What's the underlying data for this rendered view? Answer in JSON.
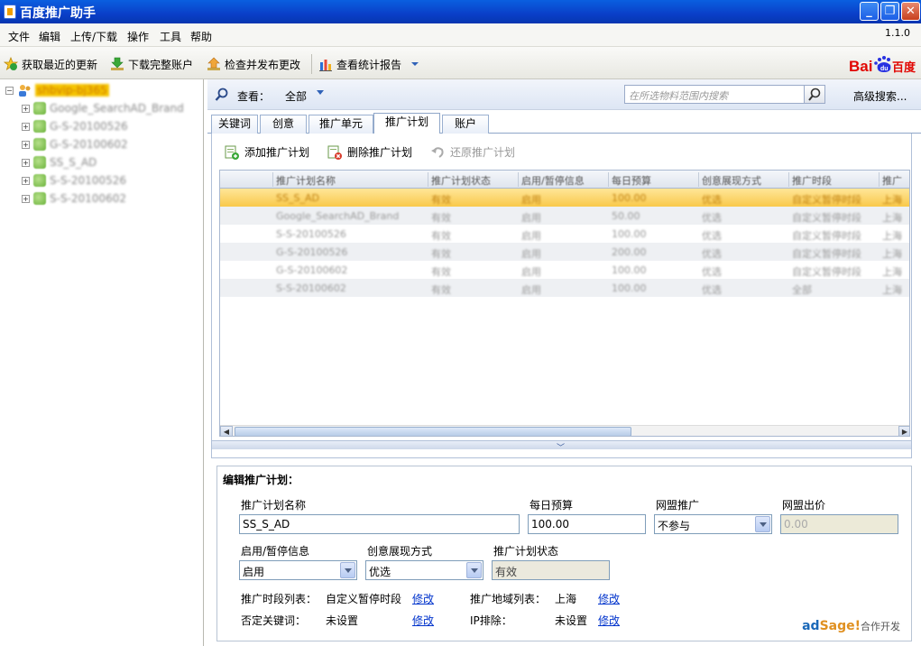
{
  "window": {
    "title": "百度推广助手",
    "version": "1.1.0"
  },
  "menu": [
    "文件",
    "编辑",
    "上传/下载",
    "操作",
    "工具",
    "帮助"
  ],
  "toolbar": {
    "get_updates": "获取最近的更新",
    "download_account": "下载完整账户",
    "check_publish": "检查并发布更改",
    "view_reports": "查看统计报告",
    "logo_text": "Baidu百度"
  },
  "tree": {
    "root": "shbvip-bj365",
    "items": [
      "Google_SearchAD_Brand",
      "G-S-20100526",
      "G-S-20100602",
      "SS_S_AD",
      "S-S-20100526",
      "S-S-20100602"
    ]
  },
  "viewbar": {
    "label": "查看：",
    "value": "全部",
    "search_placeholder": "在所选物料范围内搜索",
    "advanced_search": "高级搜索..."
  },
  "tabs": [
    "关键词",
    "创意",
    "推广单元",
    "推广计划",
    "账户"
  ],
  "actions": {
    "add": "添加推广计划",
    "delete": "删除推广计划",
    "restore": "还原推广计划"
  },
  "grid": {
    "headers": [
      "推广计划名称",
      "推广计划状态",
      "启用/暂停信息",
      "每日预算",
      "创意展现方式",
      "推广时段",
      "推广地"
    ],
    "rows": [
      [
        "SS_S_AD",
        "有效",
        "启用",
        "100.00",
        "优选",
        "自定义暂停时段",
        "上海"
      ],
      [
        "Google_SearchAD_Brand",
        "有效",
        "启用",
        "50.00",
        "优选",
        "自定义暂停时段",
        "上海"
      ],
      [
        "S-S-20100526",
        "有效",
        "启用",
        "100.00",
        "优选",
        "自定义暂停时段",
        "上海"
      ],
      [
        "G-S-20100526",
        "有效",
        "启用",
        "200.00",
        "优选",
        "自定义暂停时段",
        "上海"
      ],
      [
        "G-S-20100602",
        "有效",
        "启用",
        "100.00",
        "优选",
        "自定义暂停时段",
        "上海"
      ],
      [
        "S-S-20100602",
        "有效",
        "启用",
        "100.00",
        "优选",
        "全部",
        "上海"
      ]
    ]
  },
  "edit": {
    "title": "编辑推广计划：",
    "name_label": "推广计划名称",
    "name_value": "SS_S_AD",
    "budget_label": "每日预算",
    "budget_value": "100.00",
    "network_label": "网盟推广",
    "network_value": "不参与",
    "network_bid_label": "网盟出价",
    "network_bid_value": "0.00",
    "enable_label": "启用/暂停信息",
    "enable_value": "启用",
    "display_label": "创意展现方式",
    "display_value": "优选",
    "status_label": "推广计划状态",
    "status_value": "有效",
    "schedule_label": "推广时段列表：",
    "schedule_value": "自定义暂停时段",
    "region_label": "推广地域列表：",
    "region_value": "上海",
    "neg_kw_label": "否定关键词：",
    "neg_kw_value": "未设置",
    "ip_label": "IP排除：",
    "ip_value": "未设置",
    "modify": "修改",
    "partner_ad": "ad",
    "partner_sage": "Sage!",
    "partner_coop": "合作开发"
  }
}
